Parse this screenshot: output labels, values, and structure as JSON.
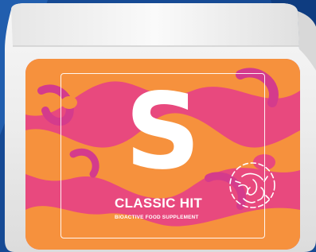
{
  "product": {
    "letter": "S",
    "name": "CLASSIC HIT",
    "subtitle": "BIOACTIVE FOOD SUPPLEMENT"
  },
  "colors": {
    "background": "#1a4f9c",
    "jar": "#f2f2f2",
    "label_orange": "#f6913d",
    "label_pink": "#e8497e",
    "label_magenta": "#d43b8c",
    "text": "#ffffff"
  },
  "icons": [
    "seed-emblem-icon"
  ]
}
